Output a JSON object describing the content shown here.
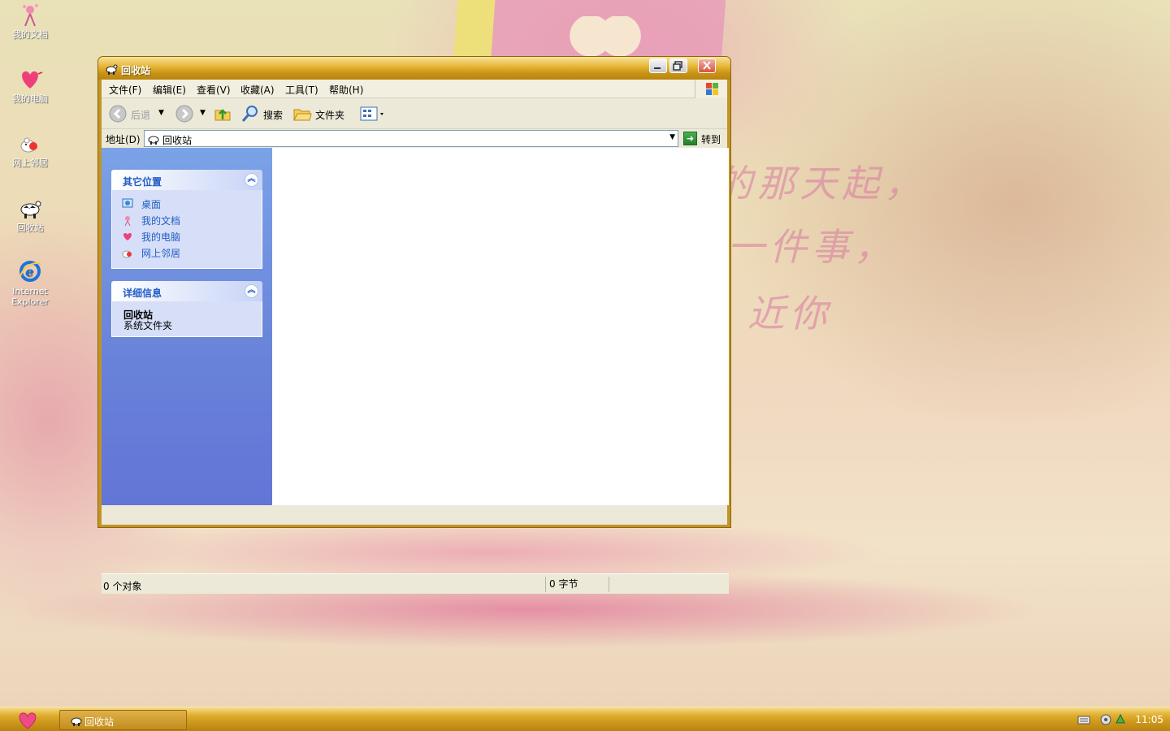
{
  "desktop": {
    "wallpaper_lines": [
      "的那天起，",
      "一件事，",
      "近你"
    ],
    "icons": [
      {
        "label": "我的文档",
        "icon": "my-documents-icon"
      },
      {
        "label": "我的电脑",
        "icon": "my-computer-icon"
      },
      {
        "label": "网上邻居",
        "icon": "network-places-icon"
      },
      {
        "label": "回收站",
        "icon": "recycle-bin-icon"
      },
      {
        "label": "Internet\nExplorer",
        "icon": "internet-explorer-icon"
      }
    ]
  },
  "window": {
    "title": "回收站",
    "menu": [
      "文件(F)",
      "编辑(E)",
      "查看(V)",
      "收藏(A)",
      "工具(T)",
      "帮助(H)"
    ],
    "toolbar": {
      "back_label": "后退",
      "search_label": "搜索",
      "folders_label": "文件夹"
    },
    "address": {
      "label": "地址(D)",
      "value": "回收站",
      "go_label": "转到"
    },
    "taskpane": {
      "other_places": {
        "title": "其它位置",
        "links": [
          {
            "label": "桌面",
            "icon": "desktop-icon"
          },
          {
            "label": "我的文档",
            "icon": "my-documents-icon"
          },
          {
            "label": "我的电脑",
            "icon": "my-computer-icon"
          },
          {
            "label": "网上邻居",
            "icon": "network-places-icon"
          }
        ]
      },
      "details": {
        "title": "详细信息",
        "name": "回收站",
        "type": "系统文件夹"
      }
    },
    "status": {
      "objects": "0 个对象",
      "size": "0 字节"
    }
  },
  "taskbar": {
    "task_label": "回收站",
    "clock": "11:05"
  },
  "colors": {
    "title_gold": "#c99516",
    "taskpane_blue": "#6882d9",
    "link_blue": "#215dc6"
  }
}
